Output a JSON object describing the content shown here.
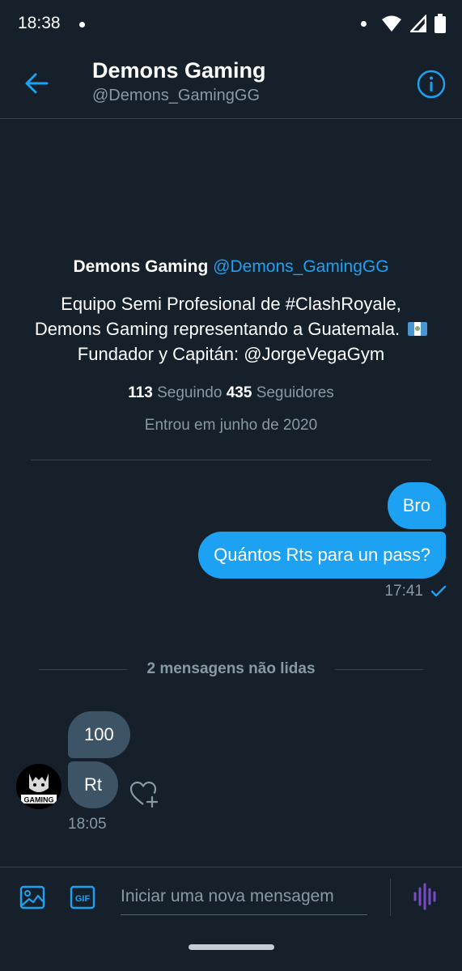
{
  "status_bar": {
    "time": "18:38"
  },
  "header": {
    "title": "Demons Gaming",
    "handle": "@Demons_GamingGG"
  },
  "profile": {
    "name": "Demons Gaming",
    "handle": "@Demons_GamingGG",
    "bio_line1": "Equipo Semi Profesional de #ClashRoyale,",
    "bio_line2": "Demons Gaming representando a Guatemala.",
    "bio_line3": "Fundador y Capitán:  @JorgeVegaGym",
    "following_count": "113",
    "following_label": "Seguindo",
    "followers_count": "435",
    "followers_label": "Seguidores",
    "joined": "Entrou em junho de 2020"
  },
  "messages": {
    "sent": [
      {
        "text": "Bro"
      },
      {
        "text": "Quántos Rts para un pass?"
      }
    ],
    "sent_time": "17:41",
    "unread_separator": "2 mensagens não lidas",
    "received": [
      {
        "text": "100"
      },
      {
        "text": "Rt"
      }
    ],
    "received_time": "18:05",
    "avatar_text": "GAMING"
  },
  "composer": {
    "placeholder": "Iniciar uma nova mensagem",
    "gif_label": "GIF"
  },
  "colors": {
    "background": "#15202b",
    "accent": "#1da1f2",
    "received_bubble": "#3d5466",
    "secondary_text": "#8899a6",
    "voice_icon": "#794bc4"
  }
}
